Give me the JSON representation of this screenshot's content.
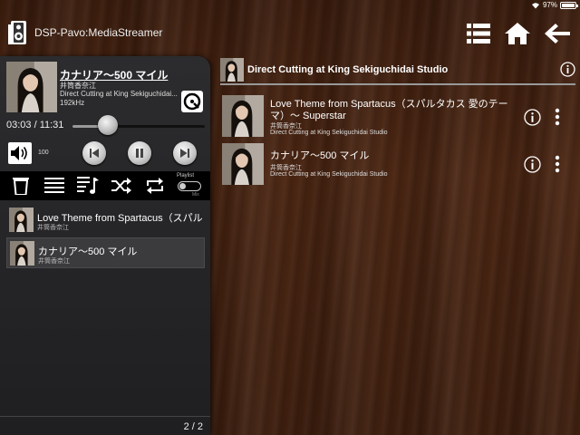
{
  "status": {
    "battery": "97%",
    "battery_level": 0.97
  },
  "app": {
    "title": "DSP-Pavo:MediaStreamer"
  },
  "header": {
    "icons": [
      "list-icon",
      "home-icon",
      "back-arrow-icon"
    ]
  },
  "now_playing": {
    "title": "カナリア〜500 マイル",
    "artist": "井筒香奈江",
    "album": "Direct Cutting at King Sekiguchidai...",
    "sample_rate": "192kHz",
    "time": "03:03 /  11:31",
    "progress": 0.265,
    "volume": "100"
  },
  "toolbar": {
    "playlist_label": "Playlist",
    "mix_label": "Mix"
  },
  "queue": [
    {
      "title": "Love Theme from Spartacus（スパルタカス 愛のテーマ）〜 Superstar",
      "artist": "井筒香奈江"
    },
    {
      "title": "カナリア〜500 マイル",
      "artist": "井筒香奈江"
    }
  ],
  "queue_page": "2 / 2",
  "album": {
    "title": "Direct Cutting at King Sekiguchidai Studio",
    "tracks": [
      {
        "title": "Love Theme from Spartacus（スパルタカス 愛のテーマ）〜 Superstar",
        "artist": "井筒香奈江",
        "album": "Direct Cutting at King Sekiguchidai Studio"
      },
      {
        "title": "カナリア〜500 マイル",
        "artist": "井筒香奈江",
        "album": "Direct Cutting at King Sekiguchidai Studio"
      }
    ]
  },
  "colors": {
    "wood": "#4a2512",
    "panel": "#2c2c2e",
    "toolbar": "#000000"
  }
}
